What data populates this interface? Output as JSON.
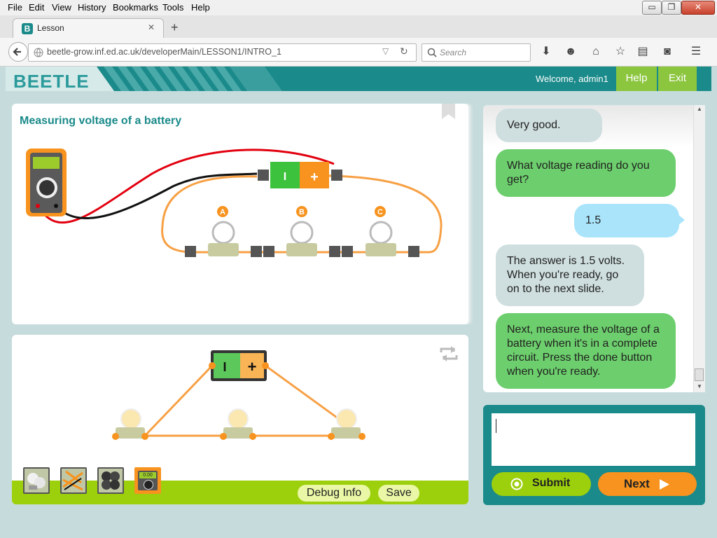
{
  "window": {
    "menu": [
      "File",
      "Edit",
      "View",
      "History",
      "Bookmarks",
      "Tools",
      "Help"
    ],
    "min_glyph": "▭",
    "max_glyph": "❐",
    "close_glyph": "✕"
  },
  "browser": {
    "tab_title": "Lesson",
    "tab_close": "✕",
    "new_tab": "+",
    "url": "beetle-grow.inf.ed.ac.uk/developerMain/LESSON1/INTRO_1",
    "search_placeholder": "Search"
  },
  "app": {
    "logo": "BEETLE",
    "welcome": "Welcome, admin1",
    "help_label": "Help",
    "exit_label": "Exit",
    "colors": {
      "teal": "#1b8a8a",
      "green": "#8cc63f",
      "orange": "#f7931e",
      "bubble_grey": "#cfdede",
      "bubble_green": "#6cce6c",
      "bubble_blue": "#a9e4fb"
    }
  },
  "slide": {
    "title": "Measuring voltage of a battery",
    "meter_reading": "",
    "battery_minus": "I",
    "battery_plus": "+",
    "bulb_labels": [
      "A",
      "B",
      "C"
    ]
  },
  "workspace": {
    "battery_minus": "I",
    "battery_plus": "+",
    "meter_tool_reading": "0.00",
    "tools": [
      "bulb-tool",
      "wire-tool",
      "battery-tool",
      "multimeter-tool"
    ],
    "debug_label": "Debug Info",
    "save_label": "Save"
  },
  "chat": {
    "messages": [
      {
        "from": "tutor",
        "text": "Very good."
      },
      {
        "from": "tutor",
        "text": "What voltage reading do you get?"
      },
      {
        "from": "student",
        "text": "1.5"
      },
      {
        "from": "tutor",
        "text": "The answer is 1.5 volts. When you're ready, go on to the next slide."
      },
      {
        "from": "tutor",
        "text": "Next, measure the voltage of a battery when it's in a complete circuit. Press the done button when you're ready."
      }
    ],
    "input_value": "",
    "submit_label": "Submit",
    "next_label": "Next"
  }
}
